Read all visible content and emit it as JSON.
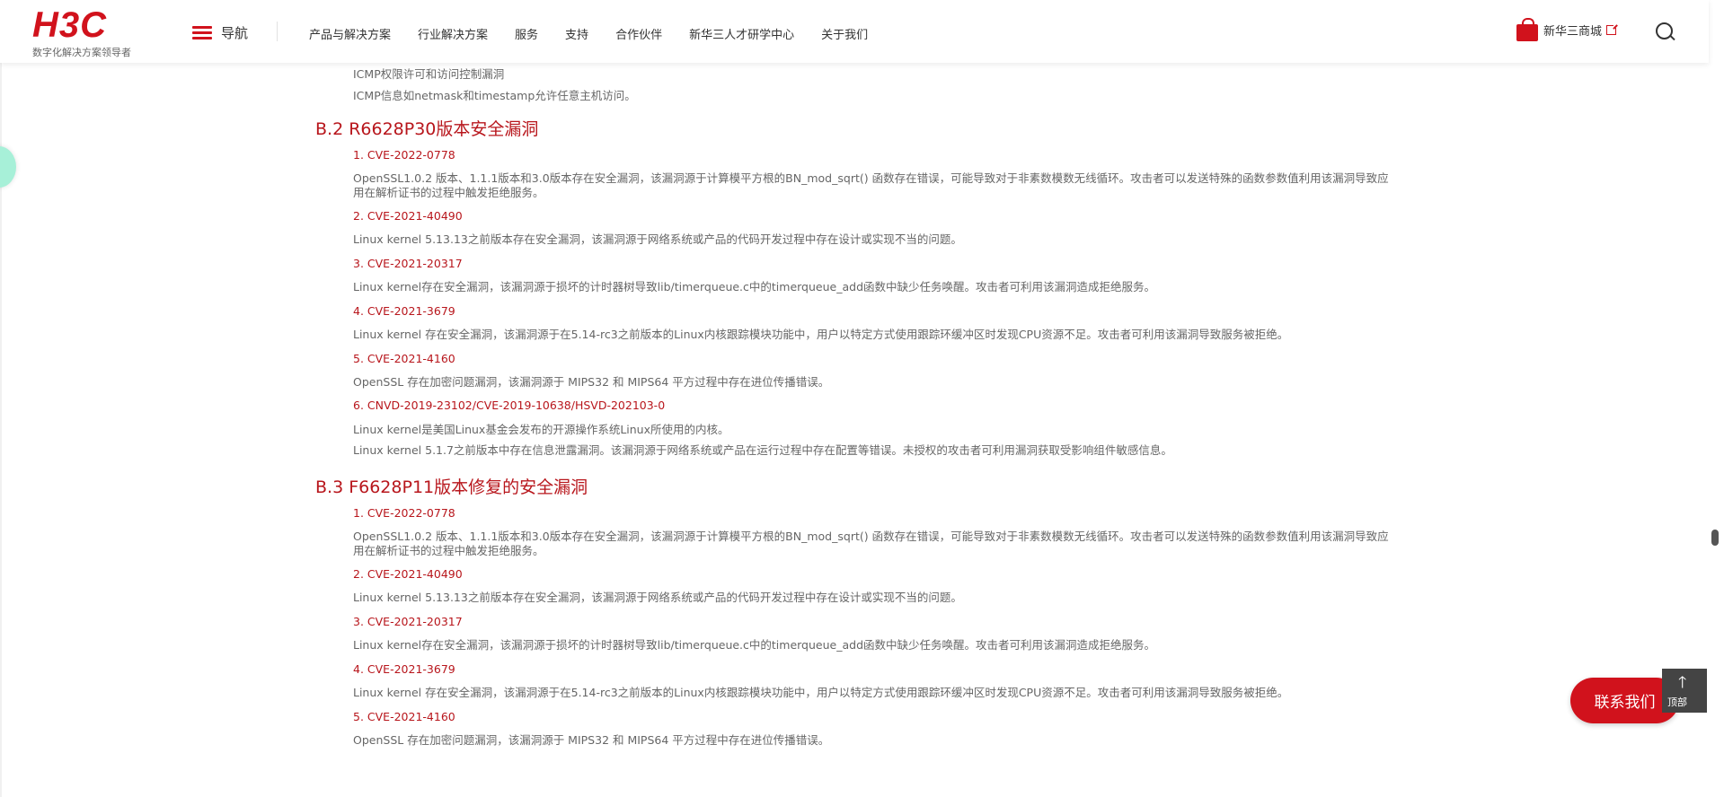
{
  "header": {
    "logo_text": "H3C",
    "logo_sub": "数字化解决方案领导者",
    "nav_label": "导航",
    "menu": [
      "产品与解决方案",
      "行业解决方案",
      "服务",
      "支持",
      "合作伙伴",
      "新华三人才研学中心",
      "关于我们"
    ],
    "shop_label": "新华三商城"
  },
  "content": {
    "top_lines": [
      "ICMP权限许可和访问控制漏洞",
      "ICMP信息如netmask和timestamp允许任意主机访问。"
    ],
    "section_b2": {
      "title": "B.2 R6628P30版本安全漏洞",
      "items": [
        {
          "cve": "1. CVE-2022-0778",
          "desc": "OpenSSL1.0.2 版本、1.1.1版本和3.0版本存在安全漏洞，该漏洞源于计算模平方根的BN_mod_sqrt() 函数存在错误，可能导致对于非素数模数无线循环。攻击者可以发送特殊的函数参数值利用该漏洞导致应用在解析证书的过程中触发拒绝服务。"
        },
        {
          "cve": "2. CVE-2021-40490",
          "desc": "Linux kernel 5.13.13之前版本存在安全漏洞，该漏洞源于网络系统或产品的代码开发过程中存在设计或实现不当的问题。"
        },
        {
          "cve": "3. CVE-2021-20317",
          "desc": "Linux kernel存在安全漏洞，该漏洞源于损坏的计时器树导致lib/timerqueue.c中的timerqueue_add函数中缺少任务唤醒。攻击者可利用该漏洞造成拒绝服务。"
        },
        {
          "cve": "4. CVE-2021-3679",
          "desc": "Linux kernel 存在安全漏洞，该漏洞源于在5.14-rc3之前版本的Linux内核跟踪模块功能中，用户以特定方式使用跟踪环缓冲区时发现CPU资源不足。攻击者可利用该漏洞导致服务被拒绝。"
        },
        {
          "cve": "5. CVE-2021-4160",
          "desc": "OpenSSL 存在加密问题漏洞，该漏洞源于 MIPS32 和 MIPS64 平方过程中存在进位传播错误。"
        },
        {
          "cve": "6. CNVD-2019-23102/CVE-2019-10638/HSVD-202103-0",
          "desc": "Linux kernel是美国Linux基金会发布的开源操作系统Linux所使用的内核。",
          "desc2": "Linux kernel 5.1.7之前版本中存在信息泄露漏洞。该漏洞源于网络系统或产品在运行过程中存在配置等错误。未授权的攻击者可利用漏洞获取受影响组件敏感信息。"
        }
      ]
    },
    "section_b3": {
      "title": "B.3 F6628P11版本修复的安全漏洞",
      "items": [
        {
          "cve": "1. CVE-2022-0778",
          "desc": "OpenSSL1.0.2 版本、1.1.1版本和3.0版本存在安全漏洞，该漏洞源于计算模平方根的BN_mod_sqrt() 函数存在错误，可能导致对于非素数模数无线循环。攻击者可以发送特殊的函数参数值利用该漏洞导致应用在解析证书的过程中触发拒绝服务。"
        },
        {
          "cve": "2. CVE-2021-40490",
          "desc": "Linux kernel 5.13.13之前版本存在安全漏洞，该漏洞源于网络系统或产品的代码开发过程中存在设计或实现不当的问题。"
        },
        {
          "cve": "3. CVE-2021-20317",
          "desc": "Linux kernel存在安全漏洞，该漏洞源于损坏的计时器树导致lib/timerqueue.c中的timerqueue_add函数中缺少任务唤醒。攻击者可利用该漏洞造成拒绝服务。"
        },
        {
          "cve": "4. CVE-2021-3679",
          "desc": "Linux kernel 存在安全漏洞，该漏洞源于在5.14-rc3之前版本的Linux内核跟踪模块功能中，用户以特定方式使用跟踪环缓冲区时发现CPU资源不足。攻击者可利用该漏洞导致服务被拒绝。"
        },
        {
          "cve": "5. CVE-2021-4160",
          "desc": "OpenSSL 存在加密问题漏洞，该漏洞源于 MIPS32 和 MIPS64 平方过程中存在进位传播错误。"
        }
      ]
    }
  },
  "widgets": {
    "contact_label": "联系我们",
    "totop_label": "顶部",
    "totop_arrow": "🡑"
  },
  "colors": {
    "brand_red": "#d1121c",
    "heading_red": "#b8161c"
  }
}
